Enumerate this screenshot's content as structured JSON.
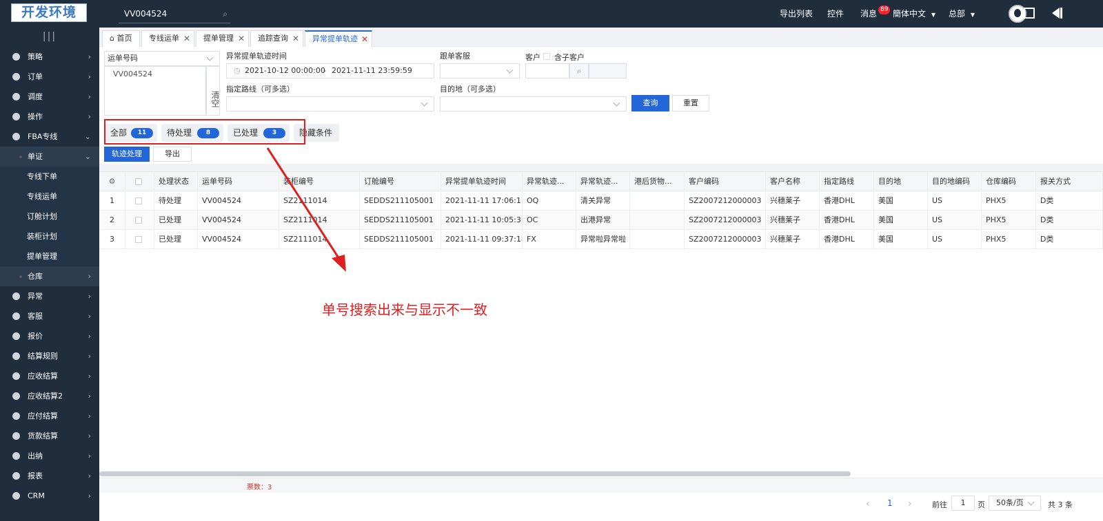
{
  "topbar": {
    "logo": "开发环境",
    "search_value": "VV004524",
    "export_list": "导出列表",
    "controls": "控件",
    "messages": "消息",
    "messages_badge": "89",
    "language": "簡体中文",
    "org": "总部"
  },
  "sidebar": {
    "toggle": "|||",
    "items": [
      {
        "label": "策略",
        "arrow": "›"
      },
      {
        "label": "订单",
        "arrow": "›"
      },
      {
        "label": "调度",
        "arrow": "›"
      },
      {
        "label": "操作",
        "arrow": "›"
      },
      {
        "label": "FBA专线",
        "arrow": "⌄"
      },
      {
        "label": "单证",
        "arrow": "⌄"
      },
      {
        "label": "专线下单"
      },
      {
        "label": "专线运单"
      },
      {
        "label": "订舱计划"
      },
      {
        "label": "装柜计划"
      },
      {
        "label": "提单管理"
      },
      {
        "label": "仓库",
        "arrow": "›"
      },
      {
        "label": "异常",
        "arrow": "›"
      },
      {
        "label": "客服",
        "arrow": "›"
      },
      {
        "label": "报价",
        "arrow": "›"
      },
      {
        "label": "结算规则",
        "arrow": "›"
      },
      {
        "label": "应收结算",
        "arrow": "›"
      },
      {
        "label": "应收结算2",
        "arrow": "›"
      },
      {
        "label": "应付结算",
        "arrow": "›"
      },
      {
        "label": "货款结算",
        "arrow": "›"
      },
      {
        "label": "出纳",
        "arrow": "›"
      },
      {
        "label": "报表",
        "arrow": "›"
      },
      {
        "label": "CRM",
        "arrow": "›"
      }
    ]
  },
  "tabs": [
    {
      "label": "首页"
    },
    {
      "label": "专线运单"
    },
    {
      "label": "提单管理"
    },
    {
      "label": "追踪查询"
    },
    {
      "label": "异常提单轨迹"
    }
  ],
  "filters": {
    "waybill_type": "运单号码",
    "waybill_value": "VV004524",
    "clear": "清空",
    "time_label": "异常提单轨迹时间",
    "time_start": "2021-10-12 00:00:00",
    "time_sep": "-",
    "time_end": "2021-11-11 23:59:59",
    "follow_cs_label": "跟单客服",
    "customer_label": "客户",
    "include_sub_label": "含子客户",
    "route_label": "指定路线（可多选）",
    "dest_label": "目的地（可多选）",
    "query": "查询",
    "reset": "重置"
  },
  "status_tabs": [
    {
      "label": "全部",
      "count": "11"
    },
    {
      "label": "待处理",
      "count": "8"
    },
    {
      "label": "已处理",
      "count": "3"
    }
  ],
  "hide_conditions": "隐藏条件",
  "actions": {
    "track_process": "轨迹处理",
    "export": "导出"
  },
  "table": {
    "headers": [
      "处理状态",
      "运单号码",
      "装柜编号",
      "订舱编号",
      "异常提单轨迹时间",
      "异常轨迹...",
      "异常轨迹...",
      "港后货物...",
      "客户编码",
      "客户名称",
      "指定路线",
      "目的地",
      "目的地编码",
      "仓库编码",
      "报关方式"
    ],
    "rows": [
      {
        "no": "1",
        "cells": [
          "待处理",
          "VV004524",
          "SZ2111014",
          "SEDDS211105001",
          "2021-11-11 17:06:11",
          "OQ",
          "清关异常",
          "",
          "SZ2007212000003",
          "兴穗莱子",
          "香港DHL",
          "美国",
          "US",
          "PHX5",
          "D类"
        ]
      },
      {
        "no": "2",
        "cells": [
          "已处理",
          "VV004524",
          "SZ2111014",
          "SEDDS211105001",
          "2021-11-11 10:05:37",
          "OC",
          "出港异常",
          "",
          "SZ2007212000003",
          "兴穗莱子",
          "香港DHL",
          "美国",
          "US",
          "PHX5",
          "D类"
        ]
      },
      {
        "no": "3",
        "cells": [
          "已处理",
          "VV004524",
          "SZ2111014",
          "SEDDS211105001",
          "2021-11-11 09:37:18",
          "FX",
          "异常啦异常啦",
          "",
          "SZ2007212000003",
          "兴穗莱子",
          "香港DHL",
          "美国",
          "US",
          "PHX5",
          "D类"
        ]
      }
    ],
    "footer_count": "票数：3"
  },
  "annotation": "单号搜索出来与显示不一致",
  "pager": {
    "prev": "‹",
    "current": "1",
    "next": "›",
    "goto_label": "前往",
    "goto_value": "1",
    "page_unit": "页",
    "page_size": "50条/页",
    "total": "共 3 条"
  },
  "colors": {
    "brand": "#2266d9",
    "topbar": "#1f2d3d",
    "annotation": "#e02020"
  }
}
